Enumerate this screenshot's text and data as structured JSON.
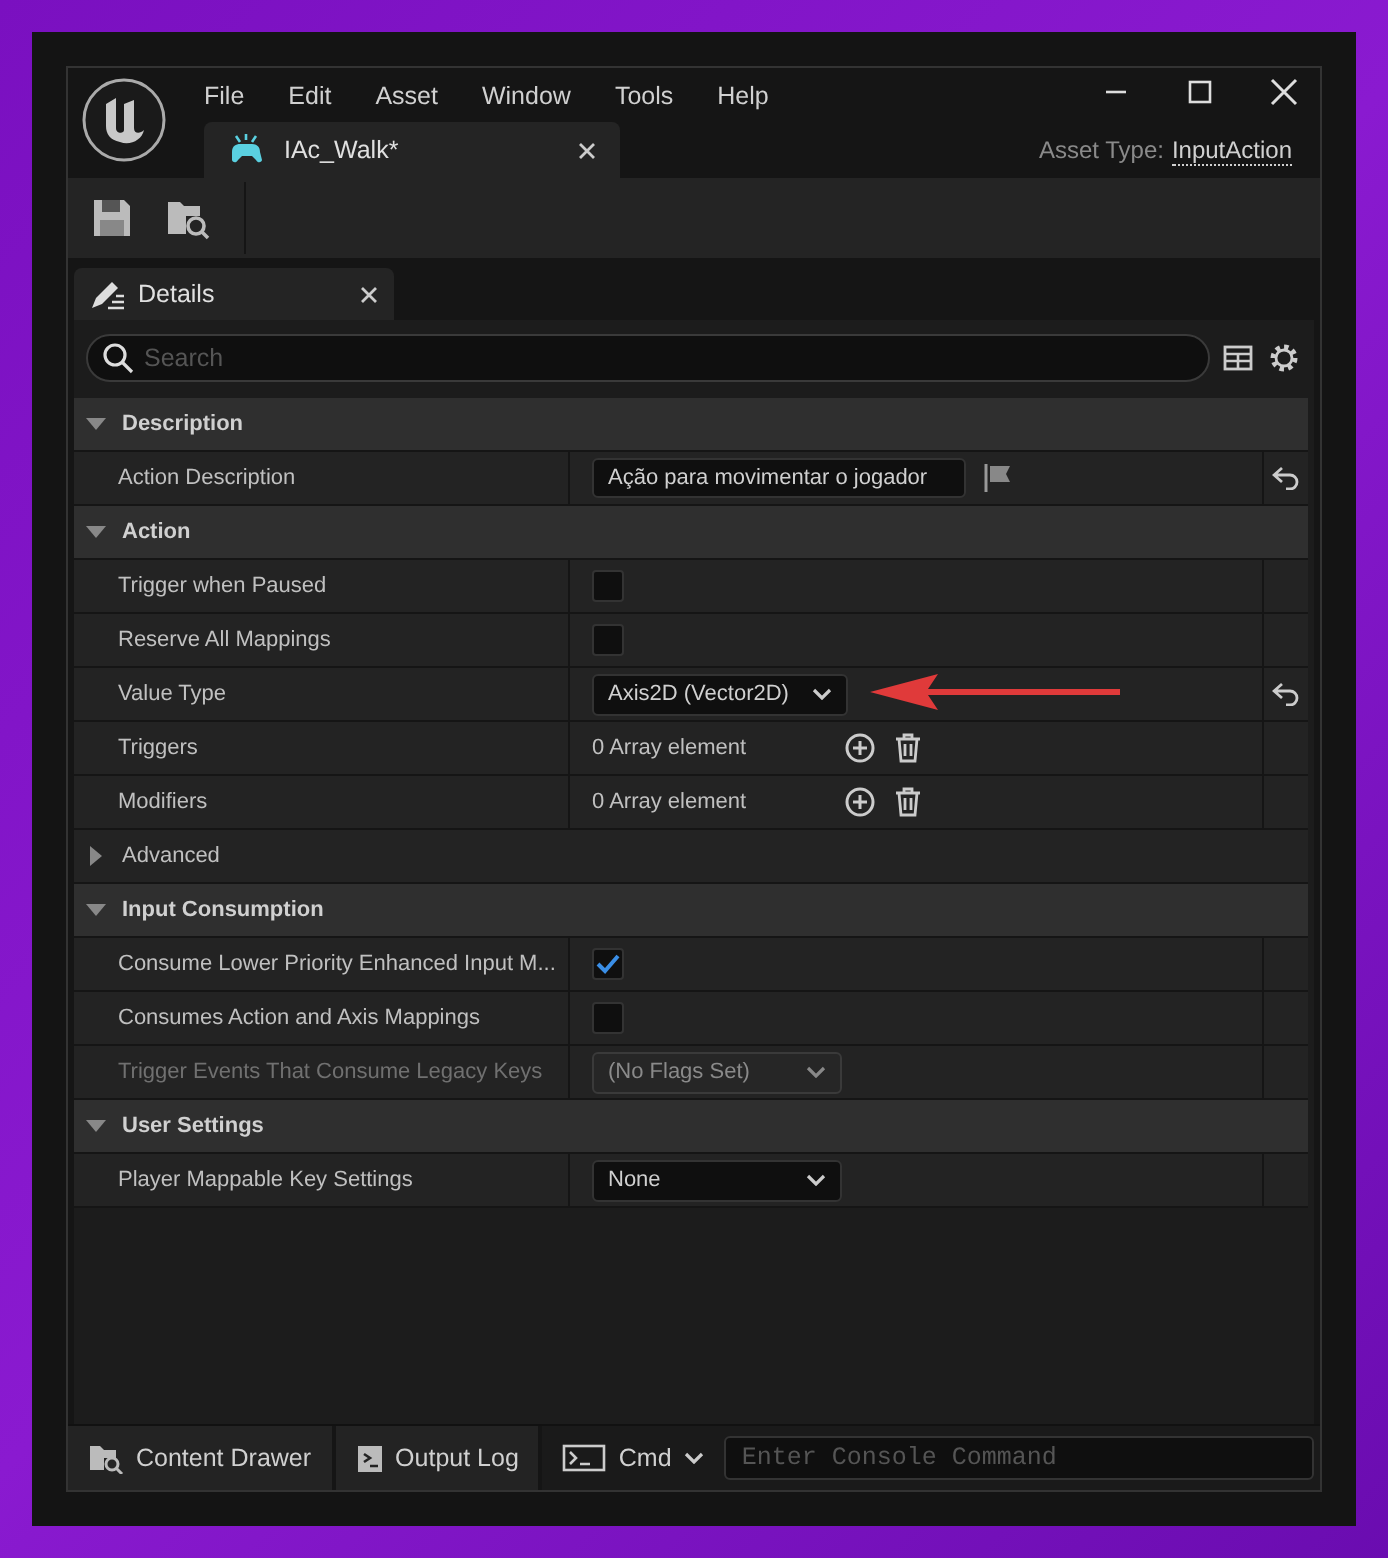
{
  "window": {
    "menu": [
      "File",
      "Edit",
      "Asset",
      "Window",
      "Tools",
      "Help"
    ],
    "asset_tab": {
      "label": "IAc_Walk*"
    },
    "asset_type_label": "Asset Type:",
    "asset_type": "InputAction"
  },
  "panel_tab": {
    "label": "Details"
  },
  "search": {
    "placeholder": "Search"
  },
  "rows": [
    {
      "kind": "section",
      "label": "Description",
      "expanded": true
    },
    {
      "kind": "text",
      "label": "Action Description",
      "value": "Ação para movimentar o jogador",
      "reset": true,
      "disabled": false
    },
    {
      "kind": "section",
      "label": "Action",
      "expanded": true
    },
    {
      "kind": "checkbox",
      "label": "Trigger when Paused",
      "checked": false,
      "reset": false,
      "disabled": false
    },
    {
      "kind": "checkbox",
      "label": "Reserve All Mappings",
      "checked": false,
      "reset": false,
      "disabled": false
    },
    {
      "kind": "dropdown",
      "label": "Value Type",
      "value": "Axis2D (Vector2D)",
      "reset": true,
      "disabled": false,
      "annotated": true
    },
    {
      "kind": "array",
      "label": "Triggers",
      "value": "0 Array element",
      "reset": false,
      "disabled": false
    },
    {
      "kind": "array",
      "label": "Modifiers",
      "value": "0 Array element",
      "reset": false,
      "disabled": false
    },
    {
      "kind": "group",
      "label": "Advanced",
      "expanded": false
    },
    {
      "kind": "section",
      "label": "Input Consumption",
      "expanded": true
    },
    {
      "kind": "checkbox",
      "label": "Consume Lower Priority Enhanced Input M...",
      "checked": true,
      "reset": false,
      "disabled": false
    },
    {
      "kind": "checkbox",
      "label": "Consumes Action and Axis Mappings",
      "checked": false,
      "reset": false,
      "disabled": false
    },
    {
      "kind": "dropdown",
      "label": "Trigger Events That Consume Legacy Keys",
      "value": "(No Flags Set)",
      "reset": false,
      "disabled": true,
      "annotated": false
    },
    {
      "kind": "section",
      "label": "User Settings",
      "expanded": true
    },
    {
      "kind": "dropdown",
      "label": "Player Mappable Key Settings",
      "value": "None",
      "reset": false,
      "disabled": false,
      "annotated": false
    }
  ],
  "status_bar": {
    "buttons": [
      {
        "kind": "drawer",
        "label": "Content Drawer"
      },
      {
        "kind": "log",
        "label": "Output Log"
      }
    ],
    "cmd": {
      "label": "Cmd"
    },
    "console": {
      "placeholder": "Enter Console Command"
    }
  }
}
